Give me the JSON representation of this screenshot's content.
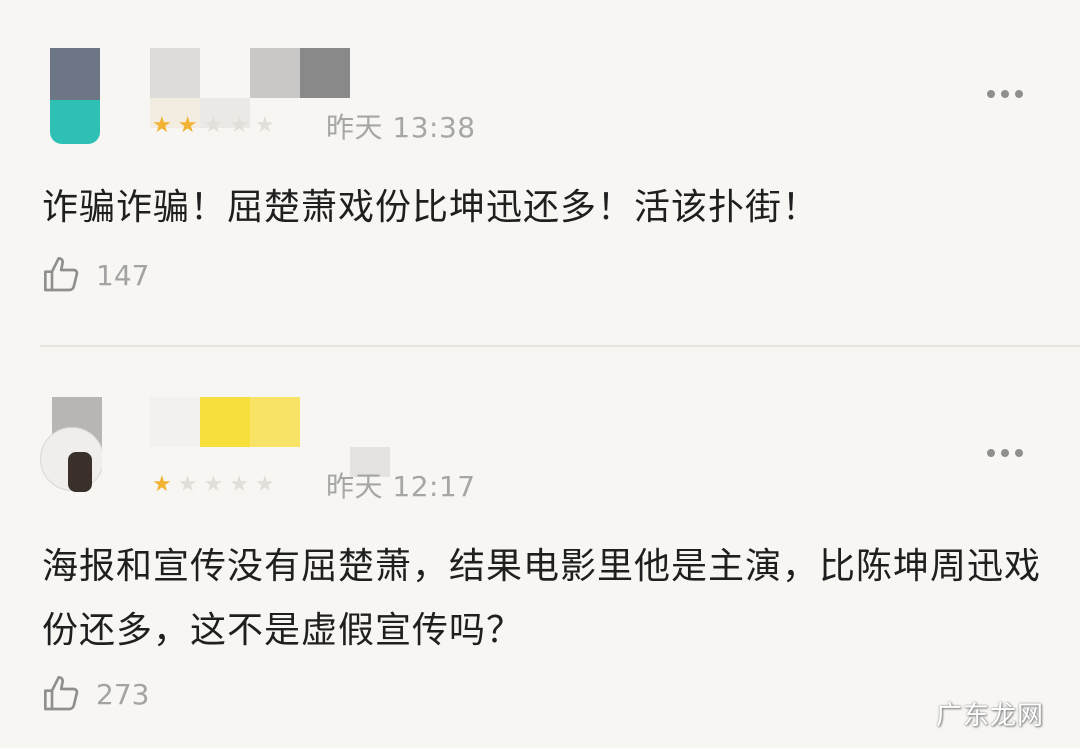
{
  "comments": [
    {
      "time": "昨天 13:38",
      "text": "诈骗诈骗！屈楚萧戏份比坤迅还多！活该扑街！",
      "likes": "147",
      "rating": 2,
      "max_rating": 5
    },
    {
      "time": "昨天 12:17",
      "text": "海报和宣传没有屈楚萧，结果电影里他是主演，比陈坤周迅戏份还多，这不是虚假宣传吗？",
      "likes": "273",
      "rating": 1,
      "max_rating": 5
    }
  ],
  "icons": {
    "more": "more-horizontal-icon",
    "like": "thumbs-up-icon",
    "star": "star-icon"
  },
  "colors": {
    "star_on": "#f2b233",
    "star_off": "#e2dfdb",
    "meta_text": "#a6a6a6",
    "background": "#f8f6f3"
  },
  "watermark": "广东龙网"
}
